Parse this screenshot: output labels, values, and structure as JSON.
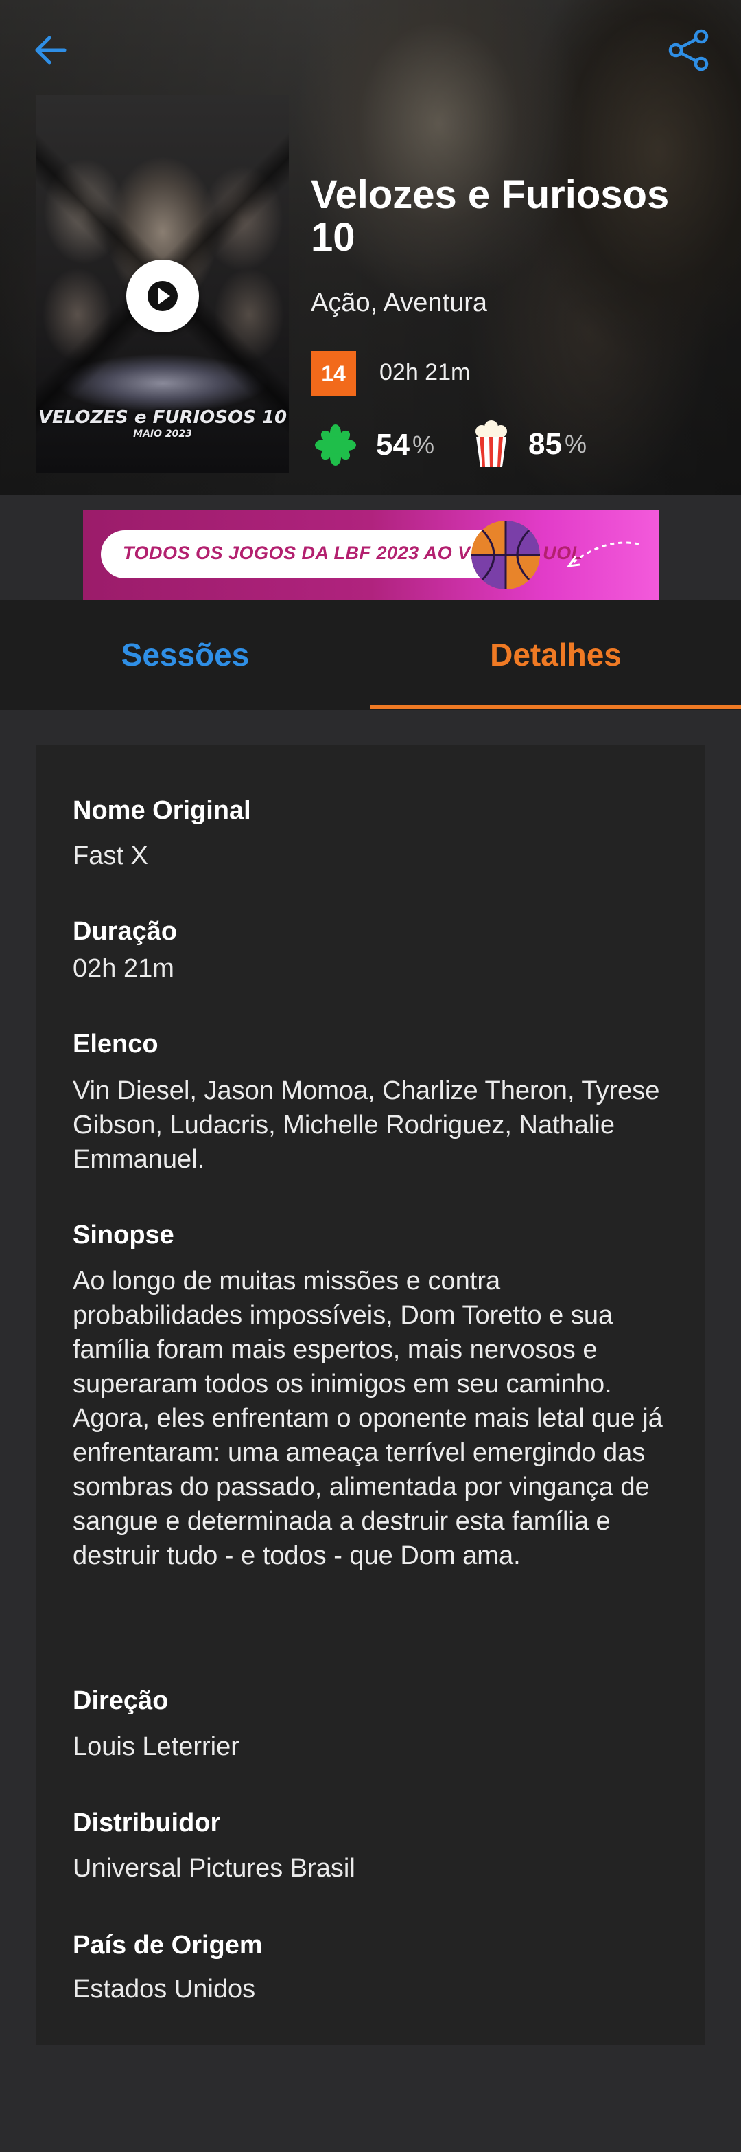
{
  "movie": {
    "title": "Velozes e Furiosos 10",
    "genres": "Ação, Aventura",
    "age_rating": "14",
    "duration": "02h 21m",
    "critics_score": "54",
    "audience_score": "85",
    "percent_sign": "%"
  },
  "poster": {
    "title_text": "VELOZES e FURIOSOS 10",
    "date_text": "MAIO 2023"
  },
  "banner": {
    "text": "TODOS OS JOGOS DA LBF 2023 AO VIVO NO UOL"
  },
  "tabs": [
    {
      "label": "Sessões",
      "active": false
    },
    {
      "label": "Detalhes",
      "active": true
    }
  ],
  "details": [
    {
      "label": "Nome Original",
      "value": "Fast X"
    },
    {
      "label": "Duração",
      "value": "02h 21m"
    },
    {
      "label": "Elenco",
      "value": "Vin Diesel, Jason Momoa, Charlize Theron, Tyrese Gibson, Ludacris, Michelle Rodriguez, Nathalie Emmanuel."
    },
    {
      "label": "Sinopse",
      "value": "Ao longo de muitas missões e contra probabilidades impossíveis, Dom Toretto e sua família foram mais espertos, mais nervosos e superaram todos os inimigos em seu caminho. Agora, eles enfrentam o oponente mais letal que já enfrentaram: uma ameaça terrível emergindo das sombras do passado, alimentada por vingança de sangue e determinada a destruir esta família e destruir tudo - e todos - que Dom ama."
    },
    {
      "label": "Direção",
      "value": "Louis Leterrier"
    },
    {
      "label": "Distribuidor",
      "value": "Universal Pictures Brasil"
    },
    {
      "label": "País de Origem",
      "value": "Estados Unidos"
    }
  ],
  "icons": {
    "back": "arrow-left-icon",
    "share": "share-icon",
    "play": "play-icon",
    "critics": "splat-icon",
    "audience": "popcorn-icon"
  },
  "colors": {
    "accent_blue": "#2f8fe6",
    "accent_orange": "#f07a24",
    "rating_badge": "#f26a1b",
    "critics_green": "#1fbe4a",
    "popcorn_red": "#e8372d"
  }
}
